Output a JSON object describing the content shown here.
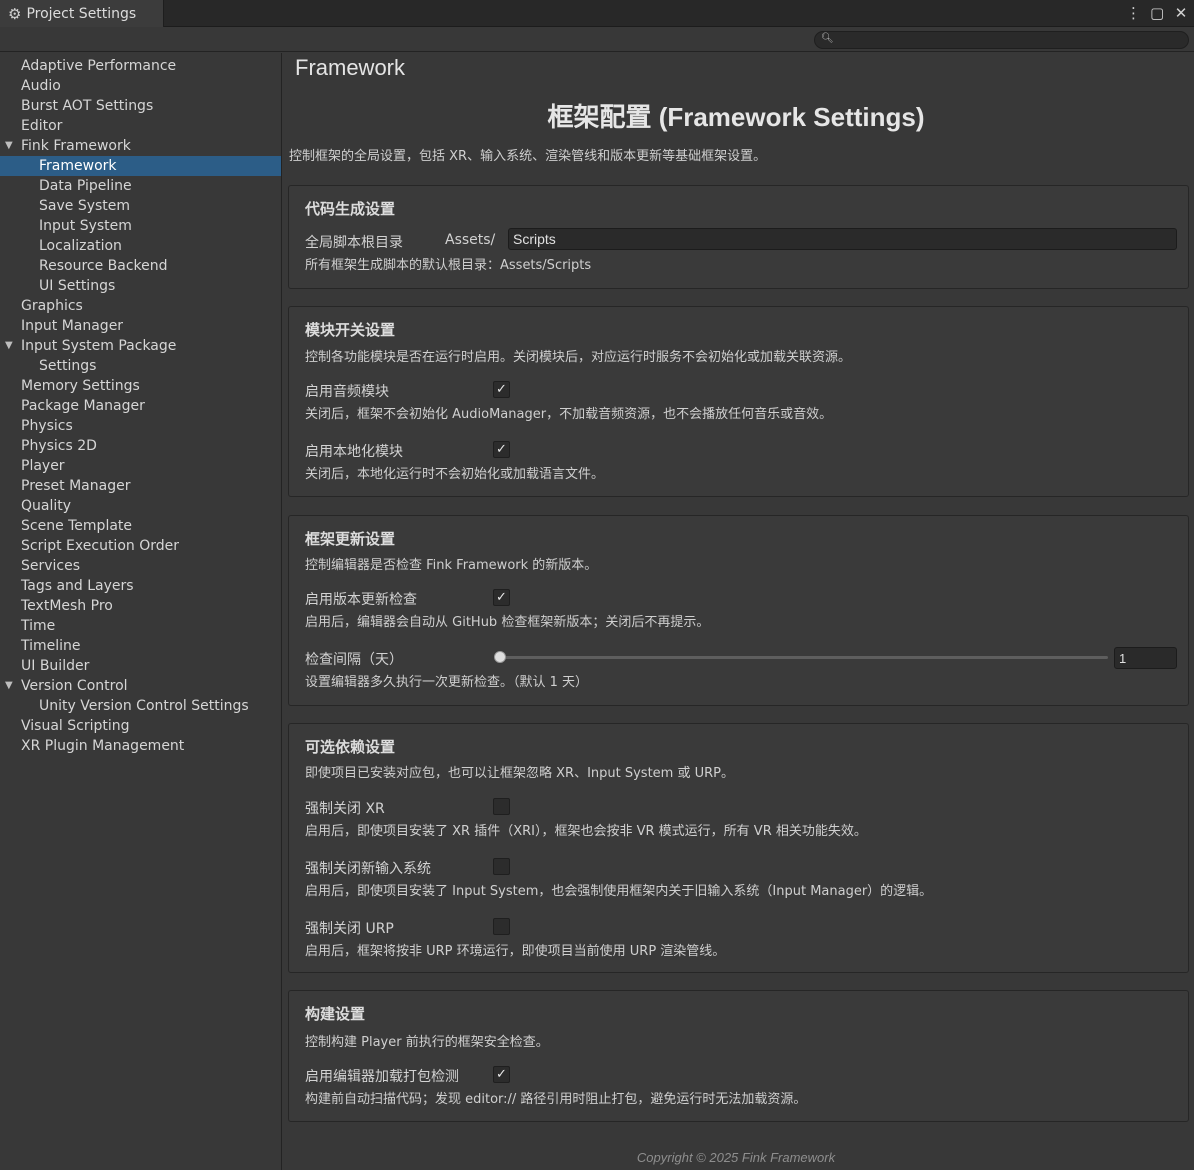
{
  "window": {
    "tab_title": "Project Settings",
    "tab_icon": "gear-icon",
    "menu_icon": "⋮",
    "maximize_icon": "▢",
    "close_icon": "✕"
  },
  "search": {
    "placeholder": "",
    "value": ""
  },
  "sidebar": {
    "items": [
      {
        "label": "Adaptive Performance",
        "level": 0
      },
      {
        "label": "Audio",
        "level": 0
      },
      {
        "label": "Burst AOT Settings",
        "level": 0
      },
      {
        "label": "Editor",
        "level": 0
      },
      {
        "label": "Fink Framework",
        "level": 0,
        "expanded": true
      },
      {
        "label": "Framework",
        "level": 1,
        "selected": true
      },
      {
        "label": "Data Pipeline",
        "level": 1
      },
      {
        "label": "Save System",
        "level": 1
      },
      {
        "label": "Input System",
        "level": 1
      },
      {
        "label": "Localization",
        "level": 1
      },
      {
        "label": "Resource Backend",
        "level": 1
      },
      {
        "label": "UI Settings",
        "level": 1
      },
      {
        "label": "Graphics",
        "level": 0
      },
      {
        "label": "Input Manager",
        "level": 0
      },
      {
        "label": "Input System Package",
        "level": 0,
        "expanded": true
      },
      {
        "label": "Settings",
        "level": 1
      },
      {
        "label": "Memory Settings",
        "level": 0
      },
      {
        "label": "Package Manager",
        "level": 0
      },
      {
        "label": "Physics",
        "level": 0
      },
      {
        "label": "Physics 2D",
        "level": 0
      },
      {
        "label": "Player",
        "level": 0
      },
      {
        "label": "Preset Manager",
        "level": 0
      },
      {
        "label": "Quality",
        "level": 0
      },
      {
        "label": "Scene Template",
        "level": 0
      },
      {
        "label": "Script Execution Order",
        "level": 0
      },
      {
        "label": "Services",
        "level": 0
      },
      {
        "label": "Tags and Layers",
        "level": 0
      },
      {
        "label": "TextMesh Pro",
        "level": 0
      },
      {
        "label": "Time",
        "level": 0
      },
      {
        "label": "Timeline",
        "level": 0
      },
      {
        "label": "UI Builder",
        "level": 0
      },
      {
        "label": "Version Control",
        "level": 0,
        "expanded": true
      },
      {
        "label": "Unity Version Control Settings",
        "level": 1
      },
      {
        "label": "Visual Scripting",
        "level": 0
      },
      {
        "label": "XR Plugin Management",
        "level": 0
      }
    ]
  },
  "main": {
    "page_title": "Framework",
    "heading": "框架配置 (Framework Settings)",
    "intro": "控制框架的全局设置，包括 XR、输入系统、渲染管线和版本更新等基础框架设置。",
    "codegen": {
      "title": "代码生成设置",
      "root_label": "全局脚本根目录",
      "prefix": "Assets/",
      "root_value": "Scripts",
      "root_desc": "所有框架生成脚本的默认根目录：Assets/Scripts"
    },
    "modules": {
      "title": "模块开关设置",
      "desc": "控制各功能模块是否在运行时启用。关闭模块后，对应运行时服务不会初始化或加载关联资源。",
      "audio_label": "启用音频模块",
      "audio_checked": true,
      "audio_desc": "关闭后，框架不会初始化 AudioManager，不加载音频资源，也不会播放任何音乐或音效。",
      "loc_label": "启用本地化模块",
      "loc_checked": true,
      "loc_desc": "关闭后，本地化运行时不会初始化或加载语言文件。"
    },
    "update": {
      "title": "框架更新设置",
      "desc": "控制编辑器是否检查 Fink Framework 的新版本。",
      "check_label": "启用版本更新检查",
      "check_checked": true,
      "check_desc": "启用后，编辑器会自动从 GitHub 检查框架新版本；关闭后不再提示。",
      "interval_label": "检查间隔（天）",
      "interval_value": "1",
      "interval_fraction": 0,
      "interval_desc": "设置编辑器多久执行一次更新检查。（默认 1 天）"
    },
    "optional": {
      "title": "可选依赖设置",
      "desc": "即使项目已安装对应包，也可以让框架忽略 XR、Input System 或 URP。",
      "xr_label": "强制关闭 XR",
      "xr_checked": false,
      "xr_desc": "启用后，即使项目安装了 XR 插件（XRI），框架也会按非 VR 模式运行，所有 VR 相关功能失效。",
      "input_label": "强制关闭新输入系统",
      "input_checked": false,
      "input_desc": "启用后，即使项目安装了 Input System，也会强制使用框架内关于旧输入系统（Input Manager）的逻辑。",
      "urp_label": "强制关闭 URP",
      "urp_checked": false,
      "urp_desc": "启用后，框架将按非 URP 环境运行，即使项目当前使用 URP 渲染管线。"
    },
    "build": {
      "title": "构建设置",
      "desc": "控制构建 Player 前执行的框架安全检查。",
      "check_label": "启用编辑器加载打包检测",
      "check_checked": true,
      "check_desc": "构建前自动扫描代码；发现 editor:// 路径引用时阻止打包，避免运行时无法加载资源。"
    },
    "copyright": "Copyright © 2025 Fink Framework"
  },
  "colors": {
    "background": "#383838",
    "selection": "#2c5d87",
    "panel": "#3a3a3a"
  }
}
